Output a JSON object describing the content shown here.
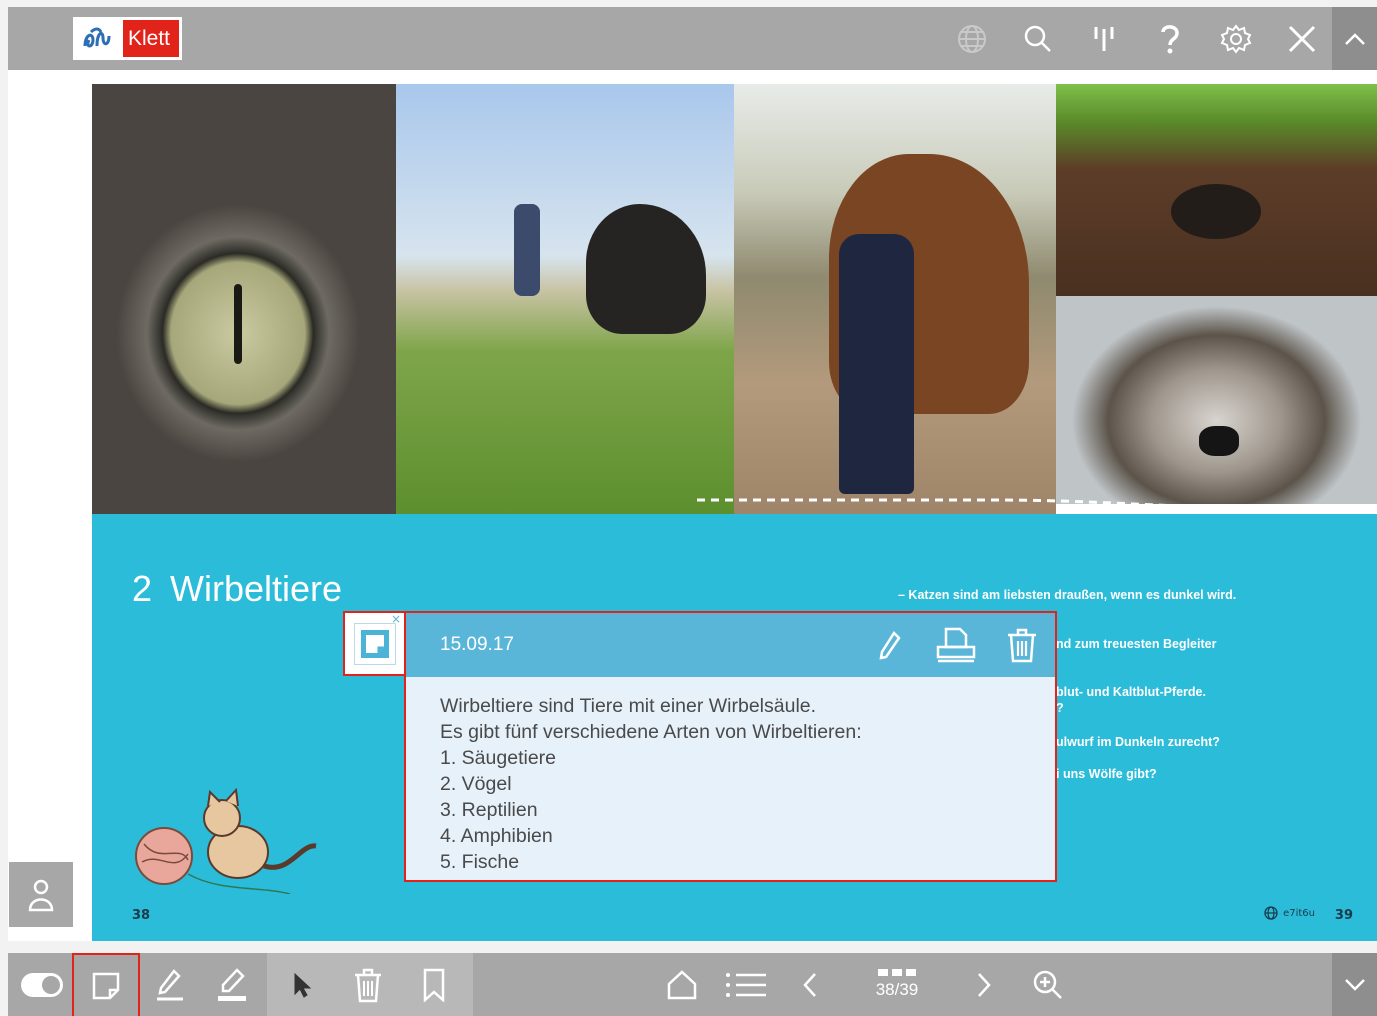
{
  "app": {
    "brand": "Klett",
    "icons": {
      "logo": "klett-logo-icon",
      "language": "globe-icon",
      "search": "search-icon",
      "toc_marker": "bookmark-bars-icon",
      "help": "help-icon",
      "settings": "gear-icon",
      "close": "close-icon",
      "collapse": "chevron-up-icon",
      "expand": "chevron-down-icon"
    },
    "colors": {
      "toolbar": "#a7a7a7",
      "accent_red": "#e2231a",
      "page_blue": "#2bbcd9",
      "note_header": "#5ab6d9",
      "note_body": "#e6f1fa"
    }
  },
  "page": {
    "chapter_number": "2",
    "chapter_title": "Wirbeltiere",
    "page_left": "38",
    "page_right": "39",
    "code": "e7it6u",
    "questions": [
      "–  Katzen sind am liebsten draußen, wenn es dunkel wird.",
      "nd zum treuesten Begleiter",
      "blut- und Kaltblut-Pferde.",
      "?",
      "ulwurf im Dunkeln zurecht?",
      "i uns Wölfe gibt?"
    ]
  },
  "note": {
    "date": "15.09.17",
    "close_label": "×",
    "lines": [
      "Wirbeltiere sind Tiere mit einer Wirbelsäule.",
      "Es gibt fünf verschiedene Arten von Wirbeltieren:",
      "1. Säugetiere",
      "2. Vögel",
      "3. Reptilien",
      "4. Amphibien",
      "5. Fische"
    ]
  },
  "bottombar": {
    "page_indicator": "38/39"
  }
}
